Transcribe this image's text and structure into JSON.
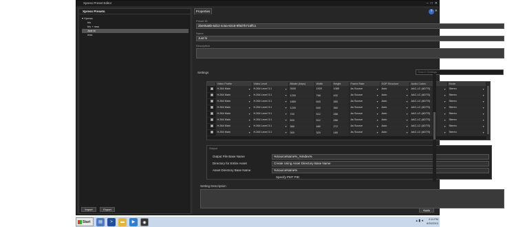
{
  "window": {
    "title": "Xpress Preset Editor",
    "min": "–",
    "max": "□",
    "close": "✕"
  },
  "left": {
    "header": "Xpress Presets",
    "tree": [
      "▾ Xpress",
      "hls",
      "hls + mss",
      "Just hi",
      "mss"
    ],
    "import": "Import",
    "export": "Export"
  },
  "tab": "Properties",
  "help": "?",
  "close": "✕",
  "fields": {
    "preset_id_label": "Preset ID",
    "preset_id": "2be05a8b-5d12-4c6a-8218-9f9d7b715ffc1",
    "name_label": "Name",
    "name": "Just hi",
    "description_label": "Description"
  },
  "settings": {
    "label": "Settings",
    "search_placeholder": "Search Settings"
  },
  "grid": {
    "headers": [
      "",
      "Video Profile",
      "Video Level",
      "Bitrate (kbps)",
      "Width",
      "Height",
      "Frame Rate",
      "GOP Structure",
      "Audio Codec",
      "Mode"
    ],
    "rows": [
      [
        "",
        "H.264 Main",
        "H.264 Level 3.1",
        "3000",
        "1920",
        "1080",
        "As Source",
        "Auto",
        "AAC-LC (ADTS)",
        "Stereo"
      ],
      [
        "",
        "H.264 Main",
        "H.264 Level 3.1",
        "1200",
        "768",
        "432",
        "As Source",
        "Auto",
        "AAC-LC (ADTS)",
        "Stereo"
      ],
      [
        "",
        "H.264 Main",
        "H.264 Level 3.1",
        "1850",
        "640",
        "360",
        "As Source",
        "Auto",
        "AAC-LC (ADTS)",
        "Stereo"
      ],
      [
        "",
        "H.264 Main",
        "H.264 Level 3.1",
        "1200",
        "640",
        "360",
        "As Source",
        "Auto",
        "AAC-LC (ADTS)",
        "Stereo"
      ],
      [
        "",
        "H.264 Main",
        "H.264 Level 3.1",
        "700",
        "512",
        "288",
        "As Source",
        "Auto",
        "AAC-LC (ADTS)",
        "Stereo"
      ],
      [
        "",
        "H.264 Main",
        "H.264 Level 3.1",
        "500",
        "512",
        "288",
        "As Source",
        "Auto",
        "AAC-LC (ADTS)",
        "Stereo"
      ],
      [
        "",
        "H.264 Main",
        "H.264 Level 3.1",
        "360",
        "480",
        "272",
        "As Source",
        "Auto",
        "AAC-LC (ADTS)",
        "Stereo"
      ],
      [
        "",
        "H.264 Main",
        "H.264 Level 3.1",
        "300",
        "320",
        "180",
        "As Source",
        "Auto",
        "AAC-LC (ADTS)",
        "Stereo"
      ]
    ]
  },
  "output": {
    "header": "Output",
    "base_name_label": "Output File Base Name",
    "base_name": "%SourceName%_%Index%",
    "dir_label": "Directory for Entire Asset",
    "dir": "Create Using Asset Directory Base Name",
    "asset_dir_label": "Asset Directory Base Name",
    "asset_dir": "%SourceName%",
    "pmt_label": "Specify PMT PID"
  },
  "description": {
    "label": "Setting Description"
  },
  "apply": "Apply",
  "taskbar": {
    "start": "Start",
    "time": "2:11 PM",
    "date": "8/29/2013"
  }
}
